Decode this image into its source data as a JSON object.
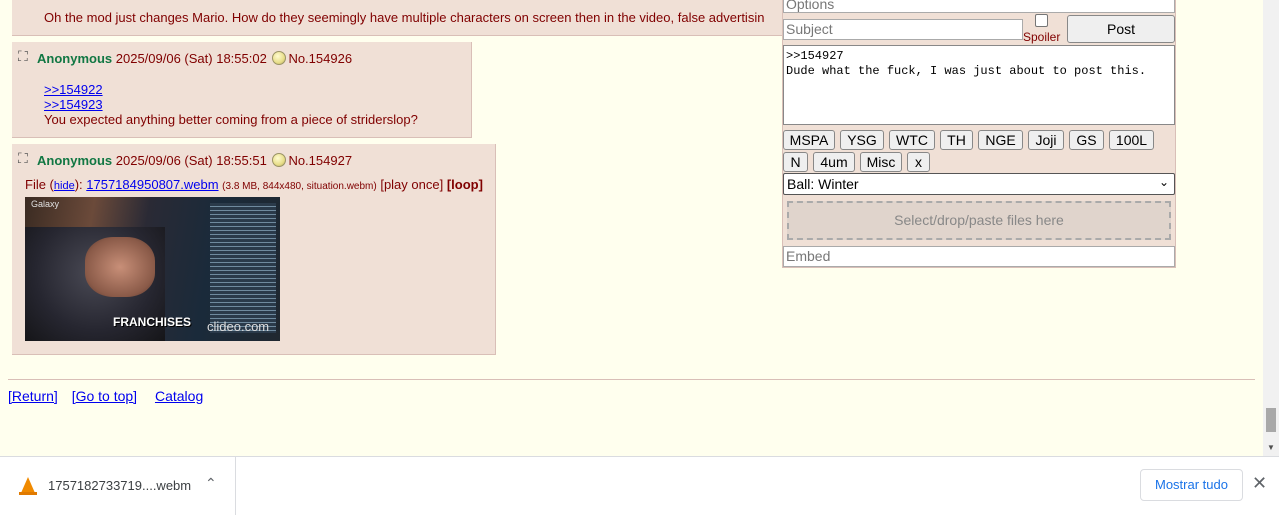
{
  "post_top": {
    "message": "Oh the mod just changes Mario. How do they seemingly have multiple characters on screen then in the video, false advertisin"
  },
  "post1": {
    "name": "Anonymous",
    "datetime": "2025/09/06 (Sat) 18:55:02",
    "number": "No.154926",
    "quotes": [
      ">>154922",
      ">>154923"
    ],
    "message": "You expected anything better coming from a piece of striderslop?"
  },
  "post2": {
    "name": "Anonymous",
    "datetime": "2025/09/06 (Sat) 18:55:51",
    "number": "No.154927",
    "file_prefix": "File (",
    "hide_label": "hide",
    "file_colon": "):",
    "file_name": "1757184950807.webm",
    "file_meta": "(3.8 MB, 844x480, situation.webm)",
    "play_once": "[play once]",
    "loop": "[loop]",
    "thumb_caption": "FRANCHISES",
    "thumb_watermark": "clideo.com",
    "thumb_tag": "Galaxy"
  },
  "nav": {
    "return": "[Return]",
    "top": "[Go to top]",
    "catalog": "Catalog"
  },
  "quick_reply": {
    "options_placeholder": "Options",
    "subject_placeholder": "Subject",
    "spoiler_label": "Spoiler",
    "post_button": "Post",
    "comment": ">>154927\nDude what the fuck, I was just about to post this.",
    "tag_buttons_row1": [
      "MSPA",
      "YSG",
      "WTC",
      "TH",
      "NGE",
      "Joji",
      "GS",
      "100L"
    ],
    "tag_buttons_row2": [
      "N",
      "4um",
      "Misc",
      "x"
    ],
    "ball_select": "Ball: Winter",
    "dropzone_text": "Select/drop/paste files here",
    "embed_placeholder": "Embed"
  },
  "download_bar": {
    "file_name": "1757182733719....webm",
    "show_all": "Mostrar tudo",
    "close_icon": "close-icon",
    "file_icon": "vlc-cone-icon"
  }
}
